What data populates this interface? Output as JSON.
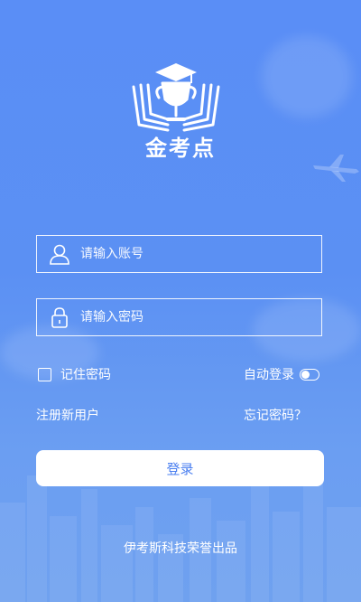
{
  "brand": {
    "name": "金考点"
  },
  "login": {
    "account_placeholder": "请输入账号",
    "password_placeholder": "请输入密码",
    "remember_label": "记住密码",
    "auto_login_label": "自动登录",
    "register_link": "注册新用户",
    "forgot_link": "忘记密码？",
    "submit_label": "登录"
  },
  "footer": {
    "text": "伊考斯科技荣誉出品"
  },
  "colors": {
    "background": "#5a8ef6",
    "button_text": "#4a7ff0"
  },
  "icons": [
    "logo-icon",
    "user-icon",
    "lock-icon",
    "checkbox",
    "toggle-icon"
  ]
}
